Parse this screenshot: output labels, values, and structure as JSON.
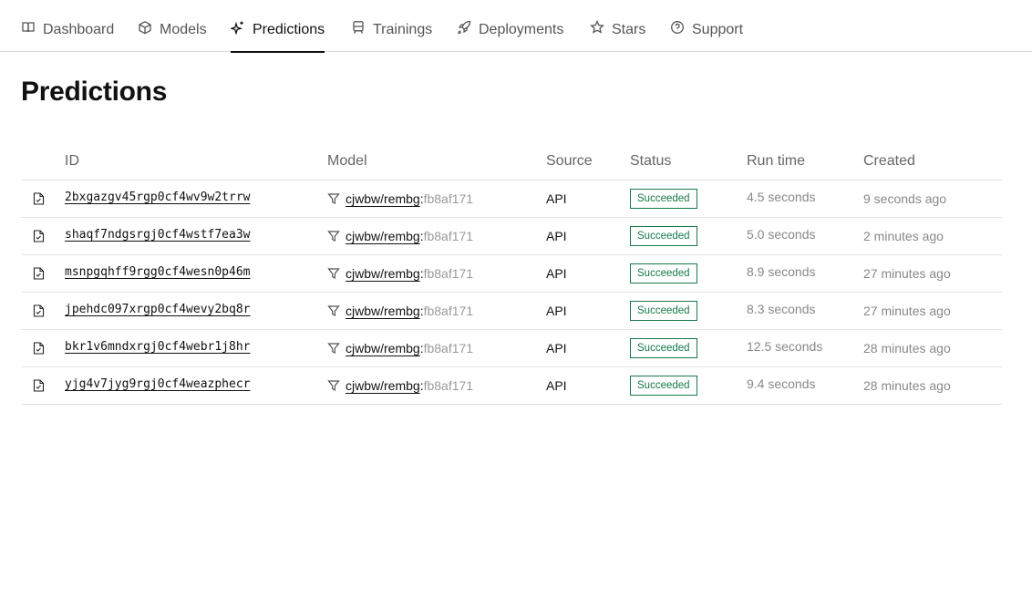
{
  "nav": {
    "tabs": [
      {
        "label": "Dashboard",
        "icon": "book-icon"
      },
      {
        "label": "Models",
        "icon": "cube-icon"
      },
      {
        "label": "Predictions",
        "icon": "sparkle-icon",
        "active": true
      },
      {
        "label": "Trainings",
        "icon": "train-icon"
      },
      {
        "label": "Deployments",
        "icon": "rocket-icon"
      },
      {
        "label": "Stars",
        "icon": "star-icon"
      },
      {
        "label": "Support",
        "icon": "help-circle-icon"
      }
    ]
  },
  "page": {
    "title": "Predictions"
  },
  "table": {
    "headers": {
      "id": "ID",
      "model": "Model",
      "source": "Source",
      "status": "Status",
      "runtime": "Run time",
      "created": "Created"
    },
    "rows": [
      {
        "id": "2bxgazgv45rgp0cf4wv9w2trrw",
        "model": "cjwbw/rembg",
        "sep": ":",
        "version": "fb8af171",
        "source": "API",
        "status": "Succeeded",
        "runtime": "4.5 seconds",
        "created": "9 seconds ago"
      },
      {
        "id": "shaqf7ndgsrgj0cf4wstf7ea3w",
        "model": "cjwbw/rembg",
        "sep": ":",
        "version": "fb8af171",
        "source": "API",
        "status": "Succeeded",
        "runtime": "5.0 seconds",
        "created": "2 minutes ago"
      },
      {
        "id": "msnpgqhff9rgg0cf4wesn0p46m",
        "model": "cjwbw/rembg",
        "sep": ":",
        "version": "fb8af171",
        "source": "API",
        "status": "Succeeded",
        "runtime": "8.9 seconds",
        "created": "27 minutes ago"
      },
      {
        "id": "jpehdc097xrgp0cf4wevy2bq8r",
        "model": "cjwbw/rembg",
        "sep": ":",
        "version": "fb8af171",
        "source": "API",
        "status": "Succeeded",
        "runtime": "8.3 seconds",
        "created": "27 minutes ago"
      },
      {
        "id": "bkr1v6mndxrgj0cf4webr1j8hr",
        "model": "cjwbw/rembg",
        "sep": ":",
        "version": "fb8af171",
        "source": "API",
        "status": "Succeeded",
        "runtime": "12.5 seconds",
        "created": "28 minutes ago"
      },
      {
        "id": "yjg4v7jyg9rgj0cf4weazphecr",
        "model": "cjwbw/rembg",
        "sep": ":",
        "version": "fb8af171",
        "source": "API",
        "status": "Succeeded",
        "runtime": "9.4 seconds",
        "created": "28 minutes ago"
      }
    ]
  },
  "colors": {
    "success": "#157a48",
    "text": "#111111",
    "muted": "#888888"
  }
}
